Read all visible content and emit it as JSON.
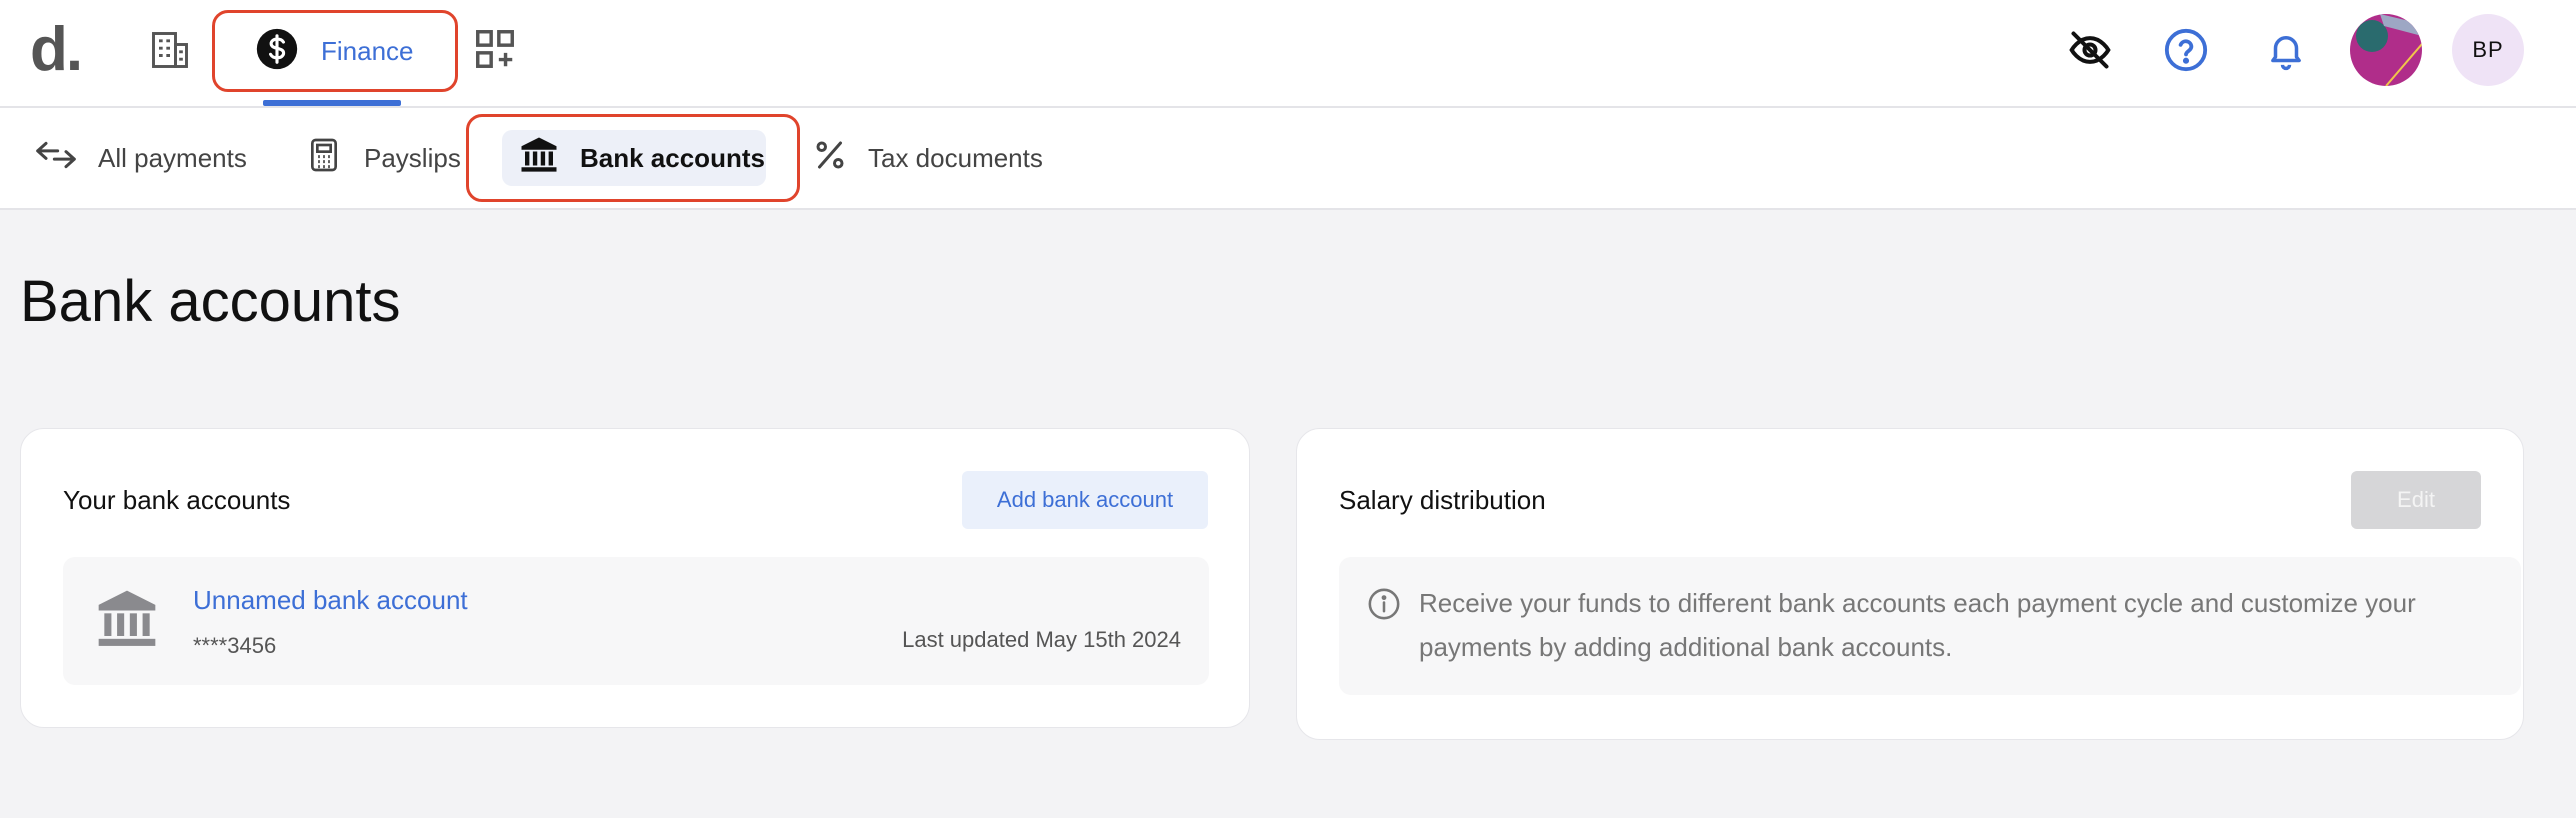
{
  "logo": "d.",
  "topnav": {
    "finance_label": "Finance"
  },
  "user": {
    "initials": "BP"
  },
  "subnav": {
    "items": [
      {
        "label": "All payments"
      },
      {
        "label": "Payslips"
      },
      {
        "label": "Bank accounts"
      },
      {
        "label": "Tax documents"
      }
    ],
    "active_index": 2
  },
  "page": {
    "title": "Bank accounts"
  },
  "bank_accounts_card": {
    "title": "Your bank accounts",
    "add_button_label": "Add bank account",
    "accounts": [
      {
        "name": "Unnamed bank account",
        "masked_number": "****3456",
        "last_updated": "Last updated May 15th 2024"
      }
    ]
  },
  "salary_card": {
    "title": "Salary distribution",
    "edit_button_label": "Edit",
    "info_text": "Receive your funds to different bank accounts each payment cycle and customize your payments by adding additional bank accounts."
  },
  "colors": {
    "accent": "#3d6fd6",
    "highlight_frame": "#e0442c",
    "background": "#f3f3f5"
  }
}
